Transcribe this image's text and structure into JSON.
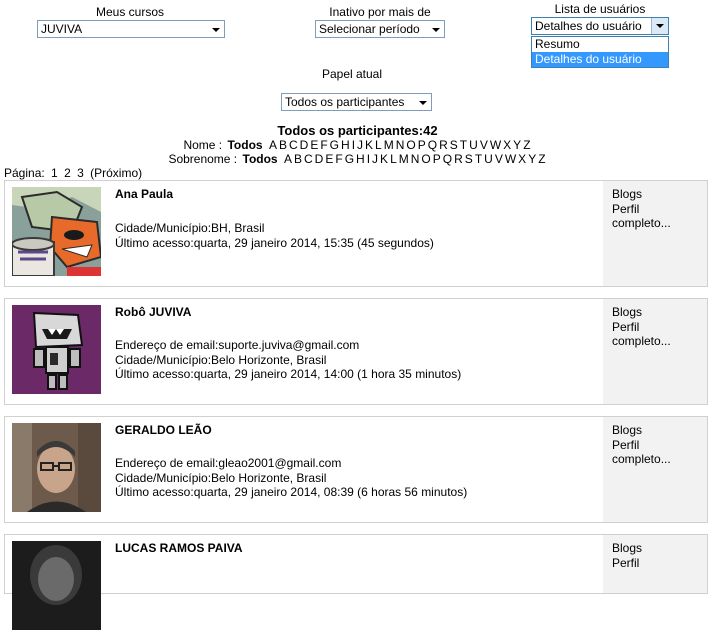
{
  "filters": {
    "courses_label": "Meus cursos",
    "courses_value": "JUVIVA",
    "inactive_label": "Inativo por mais de",
    "inactive_value": "Selecionar período",
    "userlist_label": "Lista de usuários",
    "userlist_value": "Detalhes do usuário",
    "userlist_options": [
      "Resumo",
      "Detalhes do usuário"
    ],
    "role_label": "Papel atual",
    "role_value": "Todos os participantes"
  },
  "heading": {
    "title": "Todos os participantes:42",
    "firstname_label": "Nome :",
    "lastname_label": "Sobrenome :",
    "all": "Todos",
    "letters": [
      "A",
      "B",
      "C",
      "D",
      "E",
      "F",
      "G",
      "H",
      "I",
      "J",
      "K",
      "L",
      "M",
      "N",
      "O",
      "P",
      "Q",
      "R",
      "S",
      "T",
      "U",
      "V",
      "W",
      "X",
      "Y",
      "Z"
    ]
  },
  "pagination": {
    "label": "Página:",
    "pages": [
      "1",
      "2",
      "3"
    ],
    "next": "(Próximo)"
  },
  "side_links": {
    "blogs": "Blogs",
    "profile": "Perfil",
    "complete": "completo..."
  },
  "users": [
    {
      "name": "Ana Paula",
      "email": "",
      "city": "Cidade/Município:BH, Brasil",
      "last_access": "Último acesso:quarta, 29 janeiro 2014, 15:35  (45 segundos)"
    },
    {
      "name": "Robô JUVIVA",
      "email": "Endereço de email:suporte.juviva@gmail.com",
      "city": "Cidade/Município:Belo Horizonte, Brasil",
      "last_access": "Último acesso:quarta, 29 janeiro 2014, 14:00  (1 hora 35 minutos)"
    },
    {
      "name": "GERALDO LEÃO",
      "email": "Endereço de email:gleao2001@gmail.com",
      "city": "Cidade/Município:Belo Horizonte, Brasil",
      "last_access": "Último acesso:quarta, 29 janeiro 2014, 08:39  (6 horas 56 minutos)"
    },
    {
      "name": "LUCAS RAMOS PAIVA"
    }
  ]
}
